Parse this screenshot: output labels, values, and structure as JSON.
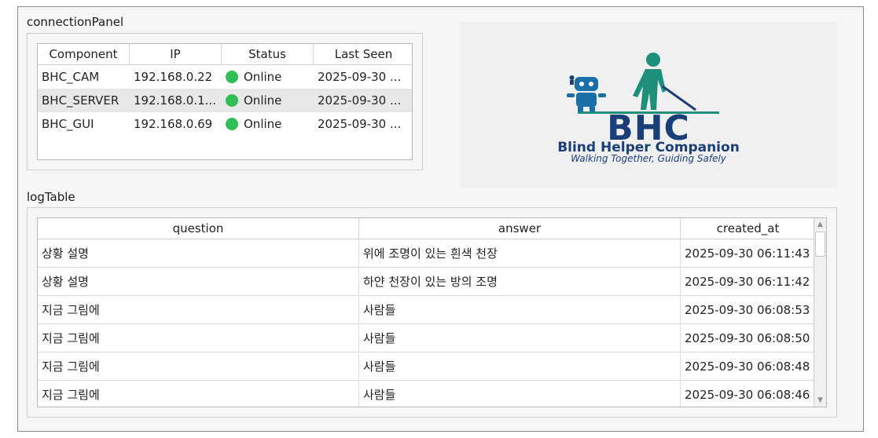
{
  "connection_panel": {
    "title": "connectionPanel",
    "columns": [
      "Component",
      "IP",
      "Status",
      "Last Seen"
    ],
    "rows": [
      {
        "component": "BHC_CAM",
        "ip": "192.168.0.22",
        "status": "Online",
        "last_seen": "2025-09-30 ..."
      },
      {
        "component": "BHC_SERVER",
        "ip": "192.168.0.1...",
        "status": "Online",
        "last_seen": "2025-09-30 ..."
      },
      {
        "component": "BHC_GUI",
        "ip": "192.168.0.69",
        "status": "Online",
        "last_seen": "2025-09-30 ..."
      }
    ],
    "status_color": "#2fbf55"
  },
  "logo": {
    "name": "BHC",
    "subtitle": "Blind Helper Companion",
    "tagline": "Walking Together, Guiding Safely",
    "brand_color": "#1a3f78",
    "accent_color": "#1e8f7a",
    "icons": [
      "robot-icon",
      "blind-walker-icon"
    ]
  },
  "log_table": {
    "title": "logTable",
    "columns": [
      "question",
      "answer",
      "created_at"
    ],
    "rows": [
      {
        "question": "상황 설명",
        "answer": "위에 조명이 있는 흰색 천장",
        "created_at": "2025-09-30 06:11:43"
      },
      {
        "question": "상황 설명",
        "answer": "하얀 천장이 있는 방의 조명",
        "created_at": "2025-09-30 06:11:42"
      },
      {
        "question": "지금 그림에",
        "answer": "사람들",
        "created_at": "2025-09-30 06:08:53"
      },
      {
        "question": "지금 그림에",
        "answer": "사람들",
        "created_at": "2025-09-30 06:08:50"
      },
      {
        "question": "지금 그림에",
        "answer": "사람들",
        "created_at": "2025-09-30 06:08:48"
      },
      {
        "question": "지금 그림에",
        "answer": "사람들",
        "created_at": "2025-09-30 06:08:46"
      }
    ]
  }
}
